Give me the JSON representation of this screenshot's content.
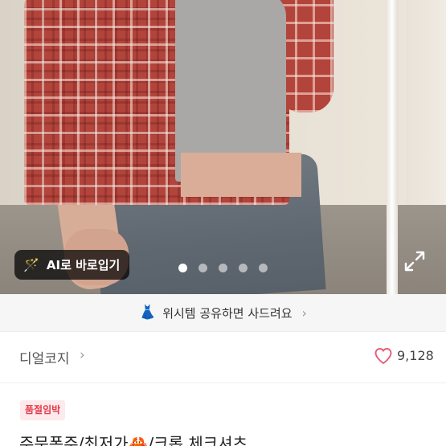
{
  "photo": {
    "ai_button_label": "AI로 바로입기",
    "ai_button_icon": "magic-wand-icon",
    "carousel_total": 5,
    "carousel_active": 1,
    "expand_icon": "expand-icon"
  },
  "wish_bar": {
    "icon": "dress-icon",
    "text": "위시템 공유하면 사드려요",
    "chevron": "›"
  },
  "shop": {
    "name": "디얼코지",
    "chevron": "›",
    "like_icon": "heart-icon",
    "like_count": "9,128",
    "like_color": "#e85a7a"
  },
  "product": {
    "badge": "품절임박",
    "badge_color": "#e33b4a",
    "title": "주문폭주/최저가🦀/크롭 체크셔츠"
  }
}
